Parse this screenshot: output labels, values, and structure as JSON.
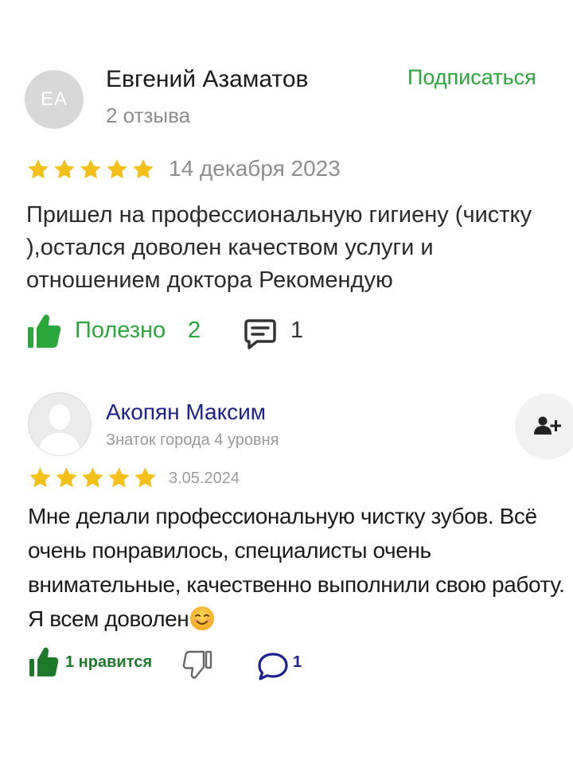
{
  "review1": {
    "avatar_initials": "ЕА",
    "author": "Евгений Азаматов",
    "reviews_count": "2 отзыва",
    "subscribe_label": "Подписаться",
    "rating": 5,
    "date": "14 декабря 2023",
    "text": "Пришел на профессиональную гигиену (чистку ),остался доволен качеством услуги и отношением доктора Рекомендую",
    "useful_label": "Полезно",
    "useful_count": "2",
    "comments_count": "1",
    "icons": [
      "thumbs-up-icon",
      "comment-icon",
      "star-icon"
    ]
  },
  "review2": {
    "author": "Акопян Максим",
    "level": "Знаток города 4 уровня",
    "rating": 5,
    "date": "3.05.2024",
    "text": "Мне делали профессиональную чистку зубов. Всё очень понравилось, специалисты очень внимательные, качественно выполнили свою работу. Я всем доволен",
    "likes_label": "1 нравится",
    "comments_count": "1",
    "icons": [
      "user-placeholder-icon",
      "add-user-icon",
      "smile-emoji-icon",
      "thumbs-up-icon",
      "thumbs-down-icon",
      "speech-bubble-icon"
    ]
  },
  "colors": {
    "star": "#f5bf1a",
    "green": "#2aa63b",
    "dark_green": "#1d7a2b",
    "navy": "#1c1f8f",
    "gray_text": "#8c8c8c"
  }
}
